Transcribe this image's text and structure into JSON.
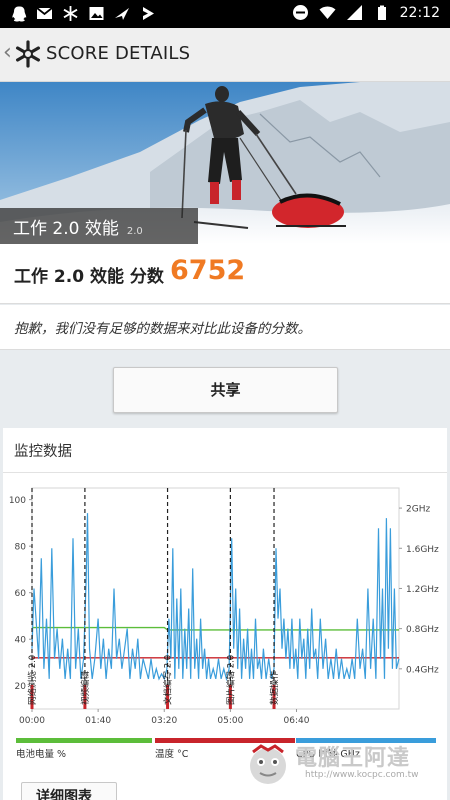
{
  "status_bar": {
    "time": "22:12",
    "left_icons": [
      "qq-icon",
      "gmail-icon",
      "snowflake-icon",
      "gallery-icon",
      "app-icon",
      "download-icon"
    ],
    "right_icons": [
      "dnd-icon",
      "wifi-icon",
      "signal-icon",
      "battery-icon"
    ]
  },
  "app_bar": {
    "title": "SCORE DETAILS",
    "back_glyph": "‹"
  },
  "hero": {
    "test_name": "工作 2.0 效能",
    "version": "2.0"
  },
  "score": {
    "label": "工作 2.0 效能 分数",
    "value": "6752"
  },
  "message": "抱歉，我们没有足够的数据来对比此设备的分数。",
  "share_label": "共享",
  "monitor": {
    "title": "监控数据",
    "detail_label": "详细图表"
  },
  "chart_data": {
    "type": "line",
    "x_ticks": [
      "00:00",
      "01:40",
      "03:20",
      "05:00",
      "06:40"
    ],
    "y_left_ticks": [
      20,
      40,
      60,
      80,
      100
    ],
    "y_right_ticks": [
      "0.4GHz",
      "0.8GHz",
      "1.2GHz",
      "1.6GHz",
      "2GHz"
    ],
    "ylim_left": [
      10,
      105
    ],
    "ylim_right_ghz": [
      0,
      2.2
    ],
    "xlim_seconds": [
      0,
      555
    ],
    "markers": [
      {
        "t": 0,
        "label": "网络浏览 2.0"
      },
      {
        "t": 80,
        "label": "视频编辑"
      },
      {
        "t": 205,
        "label": "文档编写 2.0"
      },
      {
        "t": 300,
        "label": "图片编辑 2.0"
      },
      {
        "t": 366,
        "label": "数据操作"
      }
    ],
    "legend": [
      {
        "label": "电池电量 %",
        "color": "#5cbd3a"
      },
      {
        "label": "温度 °C",
        "color": "#c8242b"
      },
      {
        "label": "CPU 时钟 GHz",
        "color": "#3a9ddb"
      }
    ],
    "series": [
      {
        "name": "电池电量 %",
        "color": "#5cbd3a",
        "axis": "left",
        "values": [
          [
            0,
            45
          ],
          [
            200,
            45
          ],
          [
            205,
            44
          ],
          [
            555,
            44
          ]
        ]
      },
      {
        "name": "温度 °C",
        "color": "#c8242b",
        "axis": "left",
        "values": [
          [
            0,
            32
          ],
          [
            555,
            32
          ]
        ]
      },
      {
        "name": "CPU 时钟 GHz",
        "color": "#3a9ddb",
        "axis": "right",
        "values": [
          [
            0,
            0.6
          ],
          [
            3,
            1.2
          ],
          [
            6,
            0.9
          ],
          [
            10,
            0.5
          ],
          [
            14,
            1.5
          ],
          [
            18,
            0.4
          ],
          [
            22,
            0.9
          ],
          [
            26,
            0.3
          ],
          [
            30,
            1.6
          ],
          [
            34,
            0.5
          ],
          [
            38,
            0.8
          ],
          [
            42,
            0.4
          ],
          [
            46,
            0.7
          ],
          [
            50,
            0.3
          ],
          [
            54,
            0.6
          ],
          [
            58,
            0.3
          ],
          [
            62,
            1.7
          ],
          [
            66,
            0.4
          ],
          [
            70,
            0.8
          ],
          [
            74,
            0.3
          ],
          [
            78,
            0.5
          ],
          [
            82,
            1.3
          ],
          [
            84,
            1.95
          ],
          [
            87,
            0.6
          ],
          [
            91,
            0.3
          ],
          [
            95,
            0.5
          ],
          [
            100,
            0.9
          ],
          [
            104,
            0.4
          ],
          [
            108,
            0.7
          ],
          [
            112,
            0.3
          ],
          [
            116,
            0.6
          ],
          [
            120,
            0.4
          ],
          [
            124,
            1.2
          ],
          [
            128,
            0.5
          ],
          [
            132,
            0.7
          ],
          [
            136,
            0.4
          ],
          [
            140,
            0.6
          ],
          [
            144,
            0.8
          ],
          [
            148,
            0.3
          ],
          [
            152,
            0.6
          ],
          [
            156,
            0.4
          ],
          [
            160,
            0.7
          ],
          [
            164,
            0.3
          ],
          [
            168,
            0.5
          ],
          [
            172,
            0.4
          ],
          [
            176,
            0.3
          ],
          [
            180,
            0.5
          ],
          [
            184,
            0.3
          ],
          [
            188,
            0.4
          ],
          [
            192,
            0.3
          ],
          [
            196,
            0.35
          ],
          [
            200,
            0.3
          ],
          [
            204,
            0.4
          ],
          [
            207,
            0.9
          ],
          [
            210,
            0.5
          ],
          [
            213,
            1.6
          ],
          [
            216,
            0.3
          ],
          [
            219,
            1.1
          ],
          [
            222,
            0.4
          ],
          [
            225,
            1.2
          ],
          [
            228,
            0.3
          ],
          [
            231,
            0.8
          ],
          [
            234,
            0.4
          ],
          [
            237,
            1.0
          ],
          [
            240,
            0.3
          ],
          [
            243,
            1.4
          ],
          [
            246,
            0.4
          ],
          [
            249,
            0.7
          ],
          [
            252,
            0.3
          ],
          [
            255,
            0.9
          ],
          [
            258,
            0.4
          ],
          [
            261,
            0.6
          ],
          [
            264,
            0.3
          ],
          [
            267,
            0.5
          ],
          [
            270,
            0.3
          ],
          [
            274,
            0.4
          ],
          [
            278,
            0.3
          ],
          [
            282,
            0.5
          ],
          [
            286,
            0.3
          ],
          [
            290,
            0.4
          ],
          [
            294,
            0.3
          ],
          [
            298,
            0.4
          ],
          [
            302,
            1.7
          ],
          [
            305,
            0.6
          ],
          [
            308,
            1.2
          ],
          [
            311,
            0.4
          ],
          [
            314,
            1.0
          ],
          [
            317,
            0.3
          ],
          [
            320,
            0.7
          ],
          [
            323,
            0.4
          ],
          [
            326,
            0.8
          ],
          [
            329,
            0.3
          ],
          [
            332,
            0.6
          ],
          [
            335,
            0.3
          ],
          [
            338,
            0.9
          ],
          [
            341,
            0.4
          ],
          [
            344,
            0.5
          ],
          [
            347,
            0.3
          ],
          [
            350,
            0.6
          ],
          [
            354,
            0.3
          ],
          [
            358,
            0.5
          ],
          [
            362,
            0.3
          ],
          [
            366,
            0.4
          ],
          [
            369,
            1.6
          ],
          [
            372,
            0.9
          ],
          [
            375,
            1.2
          ],
          [
            378,
            0.6
          ],
          [
            381,
            0.9
          ],
          [
            384,
            0.5
          ],
          [
            387,
            0.8
          ],
          [
            390,
            0.4
          ],
          [
            393,
            0.9
          ],
          [
            396,
            0.4
          ],
          [
            399,
            0.6
          ],
          [
            402,
            0.3
          ],
          [
            405,
            0.9
          ],
          [
            408,
            0.5
          ],
          [
            411,
            0.7
          ],
          [
            414,
            0.3
          ],
          [
            417,
            0.8
          ],
          [
            420,
            0.4
          ],
          [
            423,
            1.0
          ],
          [
            426,
            0.5
          ],
          [
            429,
            0.6
          ],
          [
            432,
            0.3
          ],
          [
            436,
            0.9
          ],
          [
            440,
            0.4
          ],
          [
            444,
            0.7
          ],
          [
            448,
            0.3
          ],
          [
            452,
            0.5
          ],
          [
            456,
            0.3
          ],
          [
            460,
            0.6
          ],
          [
            464,
            0.3
          ],
          [
            468,
            0.5
          ],
          [
            472,
            0.3
          ],
          [
            476,
            0.4
          ],
          [
            480,
            0.3
          ],
          [
            484,
            0.5
          ],
          [
            488,
            0.3
          ],
          [
            492,
            0.9
          ],
          [
            496,
            0.4
          ],
          [
            500,
            0.6
          ],
          [
            504,
            0.3
          ],
          [
            508,
            1.2
          ],
          [
            512,
            0.4
          ],
          [
            516,
            0.9
          ],
          [
            520,
            0.3
          ],
          [
            524,
            1.8
          ],
          [
            527,
            0.5
          ],
          [
            530,
            1.2
          ],
          [
            533,
            0.3
          ],
          [
            536,
            1.9
          ],
          [
            539,
            0.6
          ],
          [
            542,
            1.8
          ],
          [
            545,
            0.4
          ],
          [
            548,
            1.2
          ],
          [
            551,
            0.4
          ],
          [
            555,
            0.5
          ]
        ]
      }
    ]
  },
  "watermark": {
    "text": "電腦王阿達",
    "url": "http://www.kocpc.com.tw"
  }
}
